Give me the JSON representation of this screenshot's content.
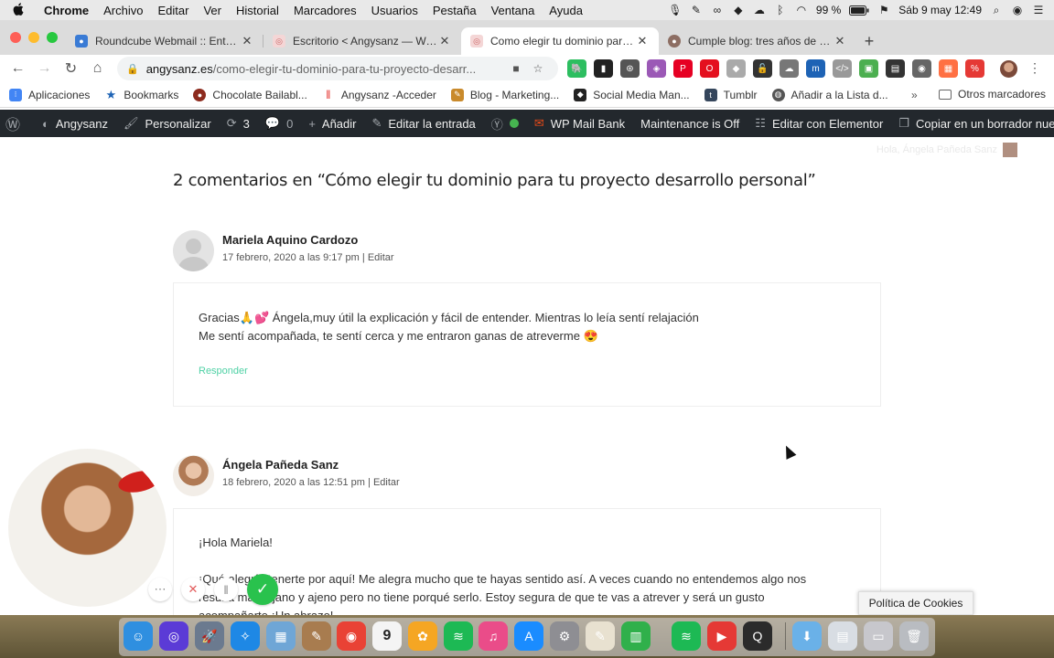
{
  "menubar": {
    "apple": "",
    "items": [
      "Chrome",
      "Archivo",
      "Editar",
      "Ver",
      "Historial",
      "Marcadores",
      "Usuarios",
      "Pestaña",
      "Ventana",
      "Ayuda"
    ],
    "battery": "99 %",
    "clock": "Sáb 9 may  12:49"
  },
  "tabs": [
    {
      "title": "Roundcube Webmail :: Entrada",
      "color": "#3a7bd5"
    },
    {
      "title": "Escritorio < Angysanz — WordPress",
      "color": "#f0b0b0"
    },
    {
      "title": "Como elegir tu dominio para tu proyecto",
      "color": "#f0b0b0",
      "active": true
    },
    {
      "title": "Cumple blog: tres años de mi emprendimiento",
      "color": "#8d6e63"
    }
  ],
  "toolbar": {
    "url_host": "angysanz.es",
    "url_path": "/como-elegir-tu-dominio-para-tu-proyecto-desarr..."
  },
  "extensions": [
    {
      "name": "evernote-icon",
      "color": "#2dbe60"
    },
    {
      "name": "bookmark-icon",
      "color": "#222"
    },
    {
      "name": "openai-icon",
      "color": "#555"
    },
    {
      "name": "color-icon",
      "color": "#9b59b6"
    },
    {
      "name": "pinterest-icon",
      "color": "#e60023"
    },
    {
      "name": "opera-icon",
      "color": "#e4101f"
    },
    {
      "name": "dropbox-icon",
      "color": "#aaa"
    },
    {
      "name": "lock-icon",
      "color": "#333"
    },
    {
      "name": "cloud-icon",
      "color": "#777"
    },
    {
      "name": "metricool-icon",
      "color": "#1e63b5"
    },
    {
      "name": "code-icon",
      "color": "#999"
    },
    {
      "name": "image-icon",
      "color": "#4caf50"
    },
    {
      "name": "window-icon",
      "color": "#333"
    },
    {
      "name": "eye-icon",
      "color": "#666"
    },
    {
      "name": "layout-icon",
      "color": "#ff7043"
    },
    {
      "name": "percent-icon",
      "color": "#e53935"
    }
  ],
  "bookmarks": {
    "items": [
      {
        "label": "Aplicaciones",
        "color": "#4285f4"
      },
      {
        "label": "Bookmarks",
        "color": "#1e63b5"
      },
      {
        "label": "Chocolate Bailabl...",
        "color": "#8d2b1e"
      },
      {
        "label": "Angysanz -Acceder",
        "color": "#e53935"
      },
      {
        "label": "Blog - Marketing...",
        "color": "#c98a2c"
      },
      {
        "label": "Social Media Man...",
        "color": "#222"
      },
      {
        "label": "Tumblr",
        "color": "#35465c"
      },
      {
        "label": "Añadir a la Lista d...",
        "color": "#555"
      }
    ],
    "more": "»",
    "other": "Otros marcadores"
  },
  "wpbar": {
    "site": "Angysanz",
    "customize": "Personalizar",
    "updates": "3",
    "comments": "0",
    "add": "Añadir",
    "edit_entry": "Editar la entrada",
    "mail": "WP Mail Bank",
    "maintenance": "Maintenance is Off",
    "elementor": "Editar con Elementor",
    "copy": "Copiar en un borrador nuevo"
  },
  "page": {
    "greeting": "Hola, Ángela Pañeda Sanz",
    "comments_title": "2 comentarios en “Cómo elegir tu dominio para tu proyecto desarrollo personal”",
    "comments": [
      {
        "author": "Mariela Aquino Cardozo",
        "date": "17 febrero, 2020 a las 9:17 pm",
        "edit": "Editar",
        "lines": [
          "Gracias🙏💕 Ángela,muy útil la explicación y fácil de entender. Mientras lo leía sentí relajación",
          "Me sentí acompañada, te sentí cerca y me entraron ganas de atreverme 😍"
        ],
        "reply": "Responder"
      },
      {
        "author": "Ángela Pañeda Sanz",
        "date": "18 febrero, 2020 a las 12:51 pm",
        "edit": "Editar",
        "lines": [
          "¡Hola Mariela!",
          "¡Qué alegría tenerte por aquí! Me alegra mucho que te hayas sentido así. A veces cuando no entendemos algo nos",
          "resulta más lejano y ajeno pero no tiene porqué serlo. Estoy segura de que te vas a atrever y será un gusto",
          "acompañarte ¡Un abrazo!"
        ]
      }
    ]
  },
  "cookies": "Política de Cookies",
  "dock": [
    {
      "name": "finder-icon",
      "color": "#2f8fe0"
    },
    {
      "name": "siri-icon",
      "color": "#5b3bd6"
    },
    {
      "name": "launchpad-icon",
      "color": "#6b7a8f"
    },
    {
      "name": "safari-icon",
      "color": "#1e88e5"
    },
    {
      "name": "preview-icon",
      "color": "#6fa6d6"
    },
    {
      "name": "notes-icon",
      "color": "#a87c4f"
    },
    {
      "name": "chrome-icon",
      "color": "#e94235"
    },
    {
      "name": "calendar-icon",
      "color": "#f4f4f4"
    },
    {
      "name": "photos-icon",
      "color": "#f5a623"
    },
    {
      "name": "spotify-icon",
      "color": "#1db954"
    },
    {
      "name": "itunes-icon",
      "color": "#ea4c89"
    },
    {
      "name": "appstore-icon",
      "color": "#1a8cff"
    },
    {
      "name": "settings-icon",
      "color": "#8e8e93"
    },
    {
      "name": "textedit-icon",
      "color": "#e8e1d0"
    },
    {
      "name": "numbers-icon",
      "color": "#30b04b"
    },
    {
      "name": "spotify2-icon",
      "color": "#1db954"
    },
    {
      "name": "screenflow-icon",
      "color": "#e53935"
    },
    {
      "name": "quicktime-icon",
      "color": "#2b2b2b"
    },
    {
      "name": "downloads-icon",
      "color": "#6ab1e8"
    },
    {
      "name": "files-icon",
      "color": "#d8dde3"
    },
    {
      "name": "stack-icon",
      "color": "#c7c7cc"
    },
    {
      "name": "trash-icon",
      "color": "#b9bcc1"
    }
  ],
  "calendar_day": "9"
}
